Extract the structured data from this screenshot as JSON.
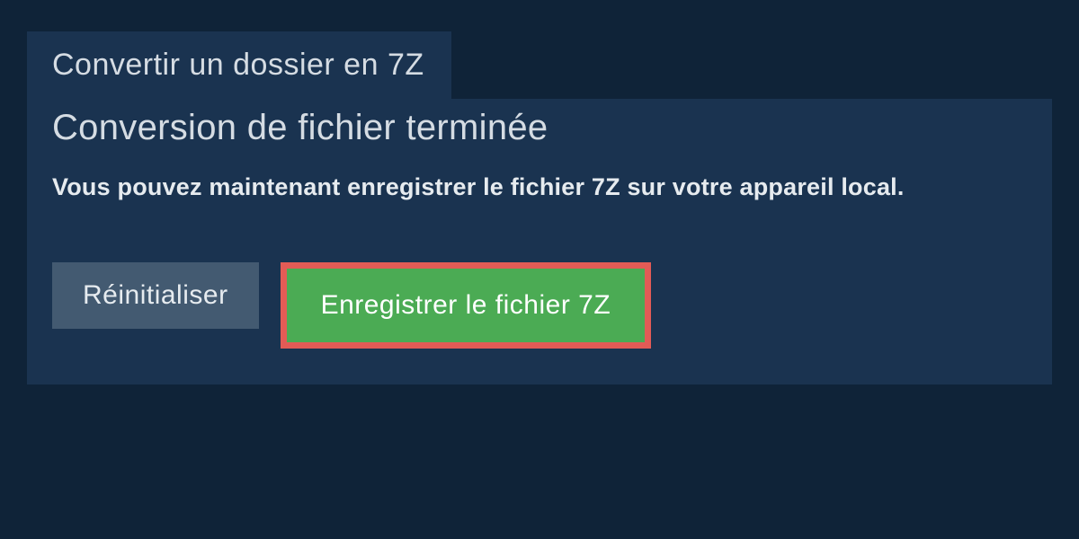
{
  "tab": {
    "label": "Convertir un dossier en 7Z"
  },
  "content": {
    "title": "Conversion de fichier terminée",
    "subtitle": "Vous pouvez maintenant enregistrer le fichier 7Z sur votre appareil local."
  },
  "buttons": {
    "reset_label": "Réinitialiser",
    "save_label": "Enregistrer le fichier 7Z"
  }
}
